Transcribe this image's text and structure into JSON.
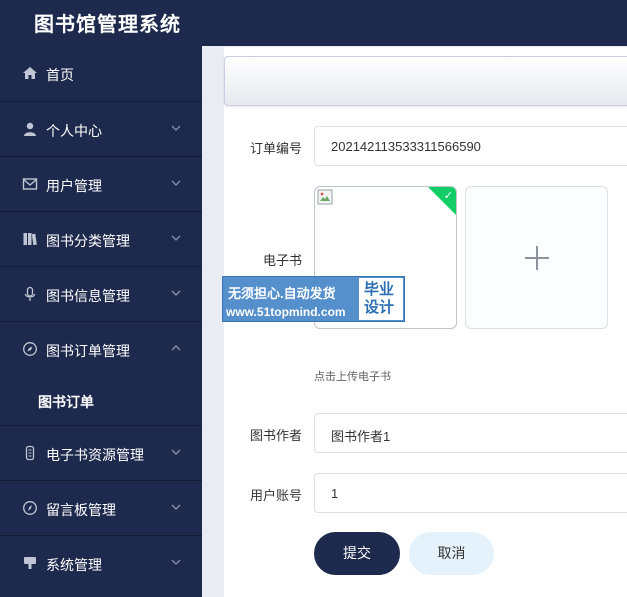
{
  "app": {
    "title": "图书馆管理系统"
  },
  "sidebar": {
    "items": [
      {
        "label": "首页",
        "icon": "home-icon"
      },
      {
        "label": "个人中心",
        "icon": "user-icon"
      },
      {
        "label": "用户管理",
        "icon": "mail-icon"
      },
      {
        "label": "图书分类管理",
        "icon": "books-icon"
      },
      {
        "label": "图书信息管理",
        "icon": "microphone-icon"
      },
      {
        "label": "图书订单管理",
        "icon": "compass-icon",
        "expanded": true
      },
      {
        "label": "电子书资源管理",
        "icon": "device-icon"
      },
      {
        "label": "留言板管理",
        "icon": "compass-icon"
      },
      {
        "label": "系统管理",
        "icon": "settings-icon"
      }
    ],
    "sub_item": {
      "label": "图书订单"
    }
  },
  "form": {
    "order_no": {
      "label": "订单编号",
      "value": "20214211353331​1566590"
    },
    "ebook": {
      "label": "电子书",
      "hint": "点击上传电子书"
    },
    "author": {
      "label": "图书作者",
      "value": "图书作者1"
    },
    "account": {
      "label": "用户账号",
      "value": "1"
    },
    "submit_label": "提交",
    "cancel_label": "取消"
  },
  "watermark": {
    "line1": "无须担心.自动发货",
    "line2": "www.51topmind.com",
    "box": "毕业设计"
  },
  "colors": {
    "sidebar": "#1d2a4d",
    "accent": "#13ce66",
    "page_bg": "#e9edf3"
  }
}
